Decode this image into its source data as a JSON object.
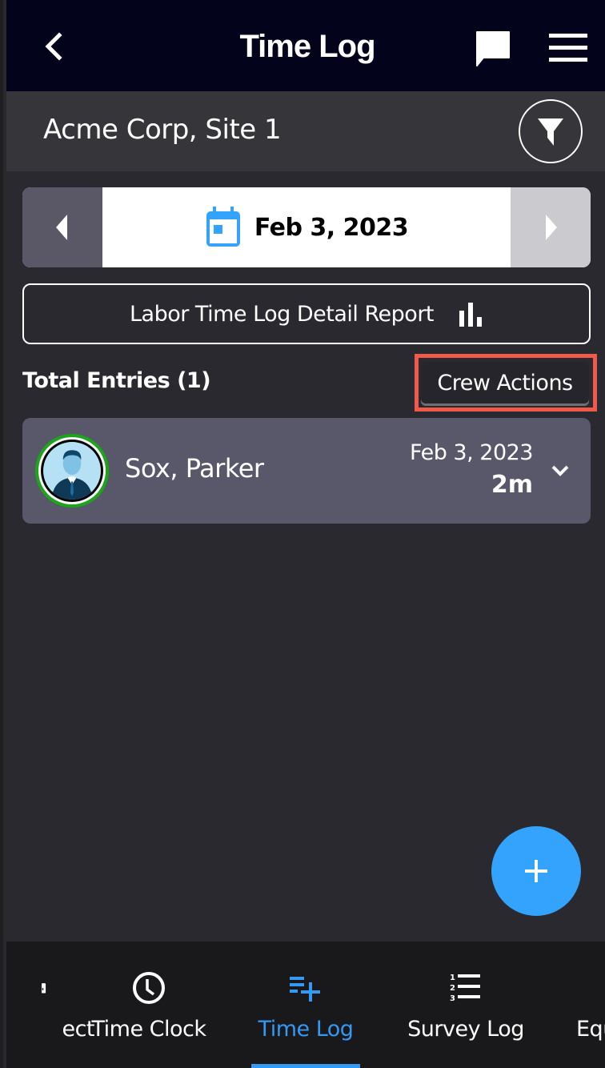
{
  "header": {
    "title": "Time Log",
    "back_icon": "chevron-left-icon",
    "chat_icon": "chat-bubble-icon",
    "menu_icon": "hamburger-menu-icon"
  },
  "subheader": {
    "site_name": "Acme Corp, Site 1",
    "filter_icon": "filter-icon"
  },
  "date_nav": {
    "date": "Feb 3, 2023",
    "calendar_icon": "calendar-icon"
  },
  "report_button": {
    "label": "Labor Time Log Detail Report",
    "icon": "bar-chart-icon"
  },
  "entries": {
    "total_label": "Total Entries (1)",
    "crew_actions_label": "Crew Actions",
    "items": [
      {
        "name": "Sox, Parker",
        "date": "Feb 3, 2023",
        "duration": "2m",
        "status_color": "#1ca51a"
      }
    ]
  },
  "fab": {
    "icon": "plus-icon"
  },
  "bottom_nav": {
    "items": [
      {
        "label": "ect",
        "icon": "project-icon",
        "active": false
      },
      {
        "label": "Time Clock",
        "icon": "clock-icon",
        "active": false
      },
      {
        "label": "Time Log",
        "icon": "list-add-icon",
        "active": true
      },
      {
        "label": "Survey Log",
        "icon": "numbered-list-icon",
        "active": false
      },
      {
        "label": "Equ",
        "icon": "equipment-icon",
        "active": false
      }
    ]
  },
  "colors": {
    "accent": "#3399f3",
    "header_bg": "#03031c",
    "highlight": "#f05a4b",
    "card_bg": "#59586a"
  }
}
